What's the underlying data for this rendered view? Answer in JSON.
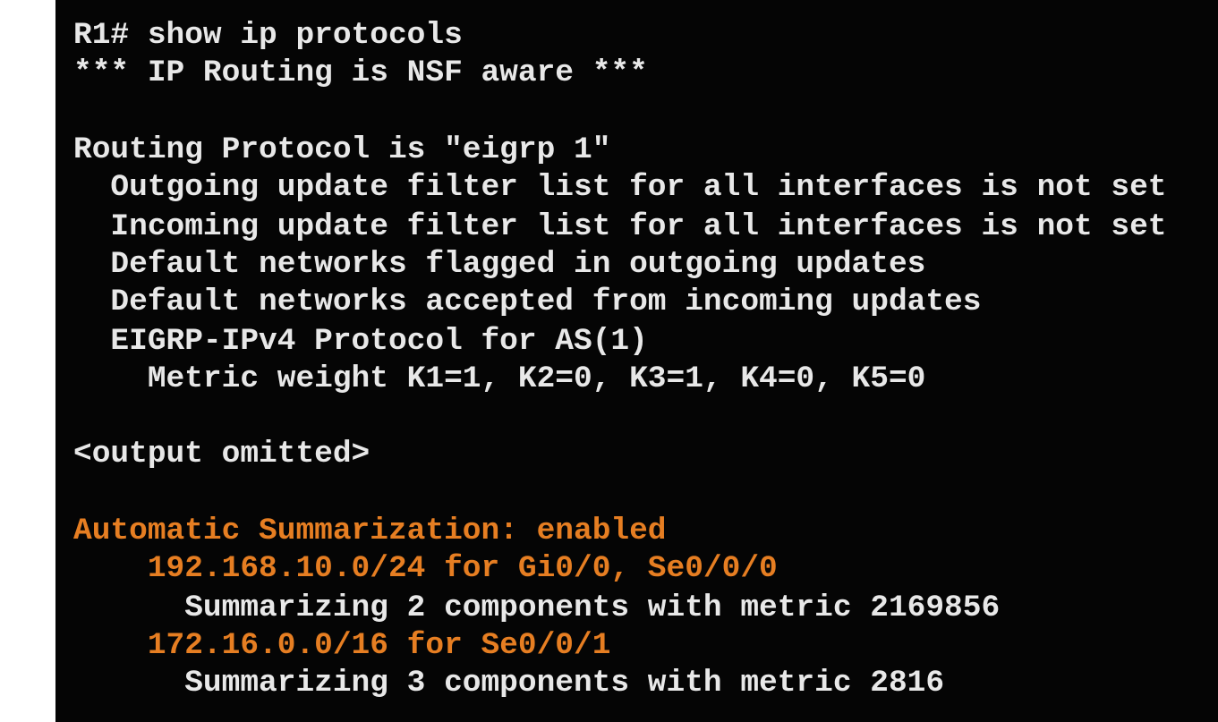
{
  "colors": {
    "background": "#050505",
    "text": "#e8e8e8",
    "highlight": "#e67e22"
  },
  "terminal": {
    "lines": [
      {
        "text": "R1# show ip protocols",
        "highlight": false
      },
      {
        "text": "*** IP Routing is NSF aware ***",
        "highlight": false
      },
      {
        "text": "Routing Protocol is \"eigrp 1\"",
        "highlight": false
      },
      {
        "text": "  Outgoing update filter list for all interfaces is not set",
        "highlight": false
      },
      {
        "text": "  Incoming update filter list for all interfaces is not set",
        "highlight": false
      },
      {
        "text": "  Default networks flagged in outgoing updates",
        "highlight": false
      },
      {
        "text": "  Default networks accepted from incoming updates",
        "highlight": false
      },
      {
        "text": "  EIGRP-IPv4 Protocol for AS(1)",
        "highlight": false
      },
      {
        "text": "    Metric weight K1=1, K2=0, K3=1, K4=0, K5=0",
        "highlight": false
      },
      {
        "text": "<output omitted>",
        "highlight": false
      },
      {
        "text": "Automatic Summarization: enabled",
        "highlight": true
      },
      {
        "text": "    192.168.10.0/24 for Gi0/0, Se0/0/0",
        "highlight": true
      },
      {
        "text": "      Summarizing 2 components with metric 2169856",
        "highlight": false
      },
      {
        "text": "    172.16.0.0/16 for Se0/0/1",
        "highlight": true
      },
      {
        "text": "      Summarizing 3 components with metric 2816",
        "highlight": false
      }
    ]
  }
}
